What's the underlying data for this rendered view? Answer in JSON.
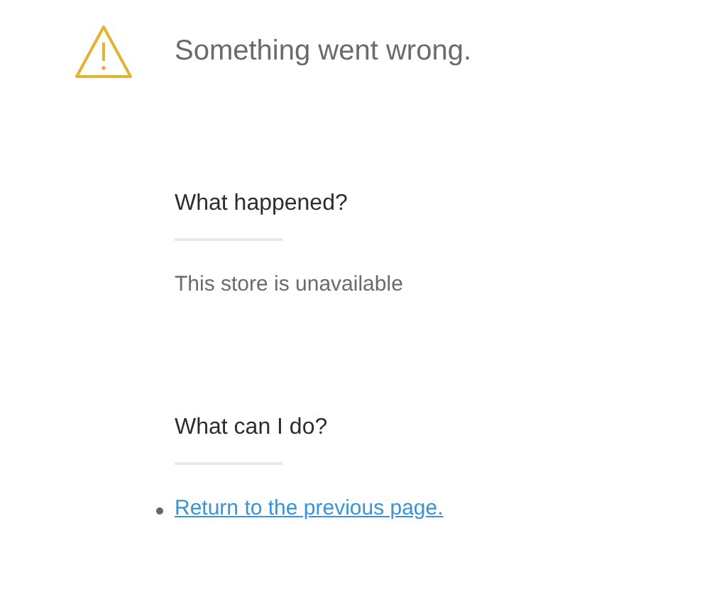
{
  "header": {
    "title": "Something went wrong."
  },
  "sections": [
    {
      "heading": "What happened?",
      "kind": "text",
      "text": "This store is unavailable"
    },
    {
      "heading": "What can I do?",
      "kind": "links",
      "links": [
        "Return to the previous page."
      ]
    }
  ]
}
